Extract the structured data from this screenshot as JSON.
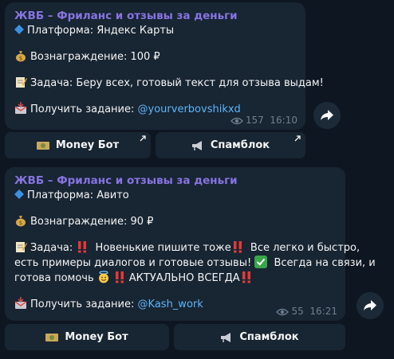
{
  "messages": [
    {
      "channel": "ЖВБ – Фриланс и отзывы за деньги",
      "platform": "Платформа: Яндекс Карты",
      "reward": "Вознаграждение: 100 ₽",
      "task": "Задача: Беру всех, готовый текст для отзыва выдам!",
      "get_task_label": "Получить задание: ",
      "handle": "@yourverbovshikxd",
      "views": "157",
      "time": "16:10",
      "buttons": [
        "Money Бот",
        "Спамблок"
      ]
    },
    {
      "channel": "ЖВБ – Фриланс и отзывы за деньги",
      "platform": "Платформа: Авито",
      "reward": "Вознаграждение: 90 ₽",
      "task_label": "Задача: ",
      "task_part1": " Новенькие пишите тоже",
      "task_part2": " Все легко и быстро,",
      "task_line2a": "есть примеры диалогов и готовые отзывы! ",
      "task_line2b": " Всегда на связи, и",
      "task_line3a": "готова помочь ",
      "task_line3b": "АКТУАЛЬНО ВСЕГДА",
      "get_task_label": "Получить задание: ",
      "handle": "@Kash_work",
      "views": "55",
      "time": "16:21",
      "buttons": [
        "Money Бот",
        "Спамблок"
      ]
    }
  ],
  "colors": {
    "background": "#0e1621",
    "bubble": "#182533",
    "channel_name": "#8774e1",
    "link": "#5eb5f7",
    "meta": "#6d7f8f"
  },
  "icons": [
    "diamond-icon",
    "money-bag-icon",
    "memo-icon",
    "inbox-tray-icon",
    "eye-icon",
    "share-icon",
    "dollar-bill-icon",
    "megaphone-icon",
    "double-exclamation-icon",
    "check-mark-icon",
    "smile-halo-icon",
    "external-arrow-icon"
  ]
}
